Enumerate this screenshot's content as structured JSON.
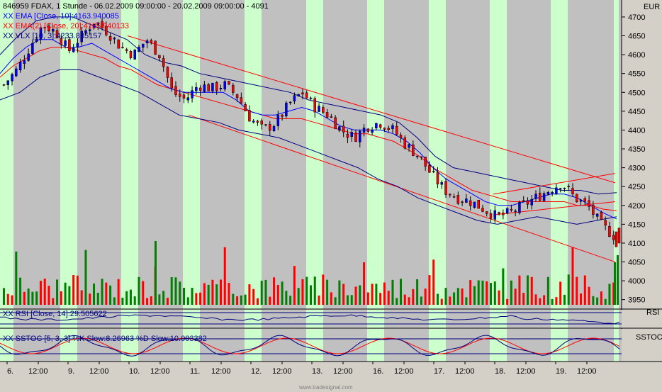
{
  "header": {
    "title_line": "846959 FDAX, 1 Stunde - 06.02.2009 09:00:00 - 20.02.2009 09:00:00 - 4091",
    "ema10_label": "XX EMA [Close, 10]:4163.940085",
    "ema20_label": "XX EMA(2) [Close, 20]:4185.940133",
    "vlx_label": "XX VLX [10, 3]:4233.835157"
  },
  "price_axis": {
    "currency": "EUR",
    "ticks": [
      "4700",
      "4650",
      "4600",
      "4550",
      "4500",
      "4450",
      "4400",
      "4350",
      "4300",
      "4250",
      "4200",
      "4150",
      "4100",
      "4050",
      "4000",
      "3950"
    ]
  },
  "rsi_panel": {
    "title": "RSI",
    "label": "XX RSI [Close, 14]:29.505622"
  },
  "stoch_panel": {
    "title": "SSTOC",
    "label": "XX SSTOC [5, 3, 3] %K Slow:8.26963 %D Slow:10.003382"
  },
  "time_axis": {
    "ticks": [
      "6.",
      "12:00",
      "9.",
      "12:00",
      "10.",
      "12:00",
      "11.",
      "12:00",
      "12.",
      "12:00",
      "13.",
      "12:00",
      "16.",
      "12:00",
      "17.",
      "12:00",
      "18.",
      "12:00",
      "19.",
      "12:00"
    ]
  },
  "watermark": "www.tradesignal.com",
  "colors": {
    "panel_bg": "#c0c0c0",
    "session_band": "#ccffcc",
    "ema10": "#0000ff",
    "ema20": "#ff0000",
    "vlx": "#000080",
    "candle_up": "#0000ff",
    "candle_down": "#ff0000",
    "volume_up": "#008000",
    "volume_down": "#ff0000",
    "channel": "#ff0000"
  },
  "chart_data": {
    "type": "candlestick",
    "instrument": "846959 FDAX",
    "interval": "1 Stunde",
    "ylim": [
      3925,
      4745
    ],
    "price_close_path": [
      4520,
      4560,
      4620,
      4680,
      4660,
      4610,
      4650,
      4690,
      4660,
      4620,
      4600,
      4640,
      4600,
      4500,
      4480,
      4520,
      4510,
      4520,
      4490,
      4430,
      4400,
      4420,
      4470,
      4500,
      4460,
      4440,
      4400,
      4380,
      4410,
      4420,
      4400,
      4360,
      4330,
      4280,
      4240,
      4220,
      4210,
      4190,
      4170,
      4180,
      4200,
      4220,
      4240,
      4260,
      4220,
      4200,
      4150,
      4120
    ],
    "ema10_path": [
      4550,
      4590,
      4620,
      4640,
      4640,
      4620,
      4620,
      4630,
      4610,
      4590,
      4570,
      4550,
      4530,
      4510,
      4500,
      4500,
      4500,
      4500,
      4480,
      4450,
      4440,
      4440,
      4450,
      4460,
      4450,
      4430,
      4410,
      4400,
      4400,
      4400,
      4390,
      4370,
      4340,
      4300,
      4270,
      4250,
      4230,
      4210,
      4200,
      4200,
      4210,
      4220,
      4230,
      4230,
      4220,
      4200,
      4180,
      4164
    ],
    "ema20_path": [
      4540,
      4570,
      4590,
      4610,
      4620,
      4620,
      4610,
      4600,
      4590,
      4570,
      4560,
      4540,
      4520,
      4510,
      4500,
      4490,
      4480,
      4470,
      4460,
      4450,
      4440,
      4430,
      4430,
      4430,
      4420,
      4410,
      4400,
      4390,
      4390,
      4380,
      4370,
      4350,
      4330,
      4300,
      4280,
      4260,
      4240,
      4230,
      4220,
      4210,
      4210,
      4210,
      4210,
      4210,
      4200,
      4200,
      4190,
      4186
    ],
    "vlx_upper_path": [
      4600,
      4650,
      4690,
      4700,
      4700,
      4680,
      4660,
      4640,
      4600,
      4580,
      4570,
      4550,
      4540,
      4530,
      4520,
      4510,
      4500,
      4480,
      4470,
      4460,
      4450,
      4440,
      4420,
      4380,
      4330,
      4300,
      4290,
      4280,
      4270,
      4260,
      4250,
      4240,
      4240,
      4230,
      4234
    ],
    "vlx_lower_path": [
      4480,
      4500,
      4540,
      4560,
      4560,
      4540,
      4520,
      4500,
      4470,
      4440,
      4430,
      4420,
      4400,
      4390,
      4380,
      4360,
      4340,
      4320,
      4300,
      4270,
      4250,
      4220,
      4200,
      4180,
      4160,
      4150,
      4160,
      4170,
      4160,
      4150,
      4160,
      4170
    ],
    "channel_lines": [
      {
        "from": [
          "10. 09:00",
          4650
        ],
        "to": [
          "20. 09:00",
          4260
        ]
      },
      {
        "from": [
          "11. 09:00",
          4440
        ],
        "to": [
          "20. 09:00",
          4050
        ]
      },
      {
        "from": [
          "18. 09:00",
          4230
        ],
        "to": [
          "20. 09:00",
          4285
        ]
      },
      {
        "from": [
          "18. 09:00",
          4175
        ],
        "to": [
          "20. 09:00",
          4210
        ]
      }
    ],
    "rsi": {
      "ylim": [
        0,
        100
      ],
      "last": 29.505622
    },
    "sstoc": {
      "ylim": [
        0,
        100
      ],
      "k_slow_last": 8.26963,
      "d_slow_last": 10.003382
    }
  }
}
